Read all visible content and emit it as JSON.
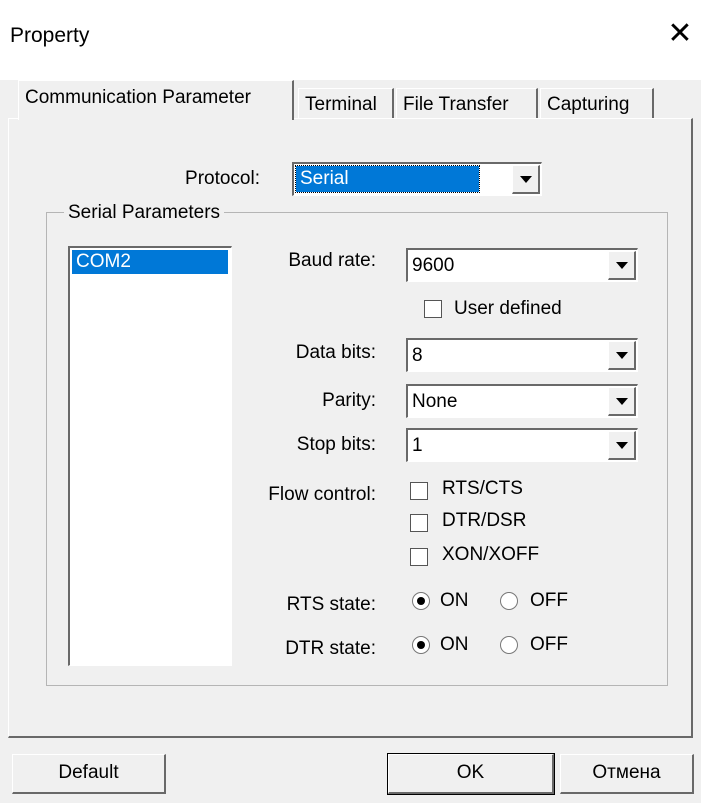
{
  "window": {
    "title": "Property",
    "close_glyph": "✕"
  },
  "tabs": [
    {
      "label": "Communication Parameter",
      "active": true
    },
    {
      "label": "Terminal",
      "active": false
    },
    {
      "label": "File Transfer",
      "active": false
    },
    {
      "label": "Capturing",
      "active": false
    }
  ],
  "protocol": {
    "label": "Protocol:",
    "value": "Serial"
  },
  "serial": {
    "group_title": "Serial Parameters",
    "ports": [
      "COM2"
    ],
    "baud_rate": {
      "label": "Baud rate:",
      "value": "9600"
    },
    "user_defined": {
      "label": "User defined",
      "checked": false
    },
    "data_bits": {
      "label": "Data bits:",
      "value": "8"
    },
    "parity": {
      "label": "Parity:",
      "value": "None"
    },
    "stop_bits": {
      "label": "Stop bits:",
      "value": "1"
    },
    "flow_control": {
      "label": "Flow control:",
      "options": [
        {
          "label": "RTS/CTS",
          "checked": false
        },
        {
          "label": "DTR/DSR",
          "checked": false
        },
        {
          "label": "XON/XOFF",
          "checked": false
        }
      ]
    },
    "rts_state": {
      "label": "RTS state:",
      "on_label": "ON",
      "off_label": "OFF",
      "selected": "ON"
    },
    "dtr_state": {
      "label": "DTR state:",
      "on_label": "ON",
      "off_label": "OFF",
      "selected": "ON"
    }
  },
  "buttons": {
    "default": "Default",
    "ok": "OK",
    "cancel": "Отмена"
  }
}
